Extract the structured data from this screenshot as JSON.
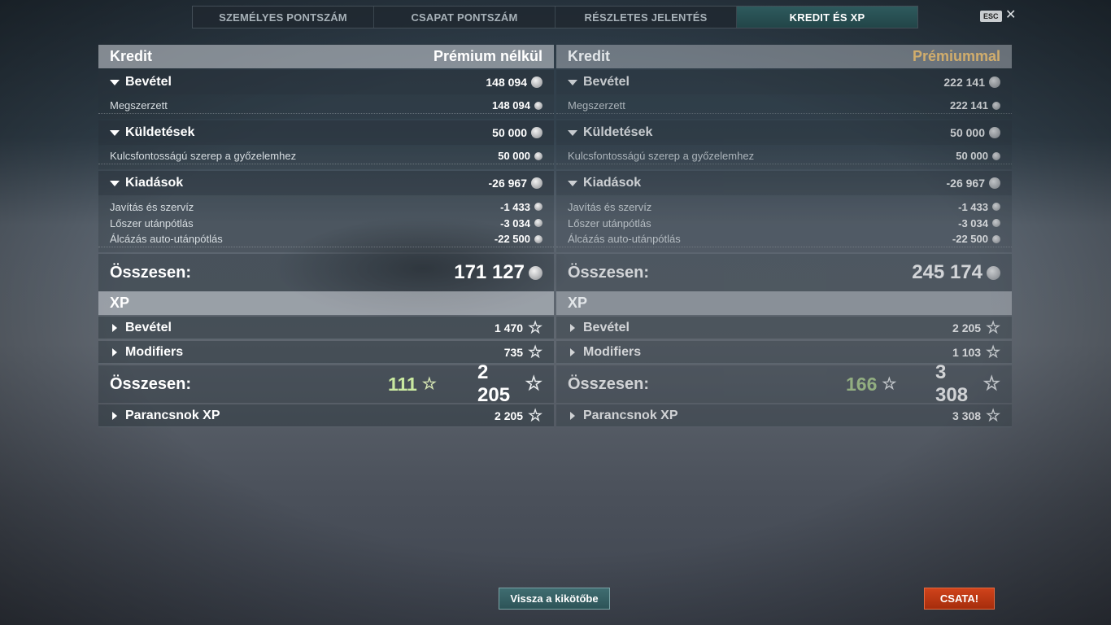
{
  "tabs": [
    {
      "label": "SZEMÉLYES PONTSZÁM"
    },
    {
      "label": "CSAPAT PONTSZÁM"
    },
    {
      "label": "RÉSZLETES JELENTÉS"
    },
    {
      "label": "KREDIT ÉS XP"
    }
  ],
  "esc_label": "ESC",
  "close_glyph": "✕",
  "left": {
    "header": {
      "title": "Kredit",
      "mode": "Prémium nélkül"
    },
    "bevetel": {
      "label": "Bevétel",
      "value": "148 094"
    },
    "megszerzett": {
      "label": "Megszerzett",
      "value": "148 094"
    },
    "kuldetesek": {
      "label": "Küldetések",
      "value": "50 000"
    },
    "kulcs": {
      "label": "Kulcsfontosságú szerep a győzelemhez",
      "value": "50 000"
    },
    "kiadasok": {
      "label": "Kiadások",
      "value": "-26 967"
    },
    "javitas": {
      "label": "Javítás és szervíz",
      "value": "-1 433"
    },
    "loszer": {
      "label": "Lőszer utánpótlás",
      "value": "-3 034"
    },
    "alcazas": {
      "label": "Álcázás auto-utánpótlás",
      "value": "-22 500"
    },
    "total": {
      "label": "Összesen:",
      "value": "171 127"
    },
    "xp_header": "XP",
    "xp_bevetel": {
      "label": "Bevétel",
      "value": "1 470"
    },
    "xp_mod": {
      "label": "Modifiers",
      "value": "735"
    },
    "xp_total": {
      "label": "Összesen:",
      "free": "111",
      "value": "2 205"
    },
    "parancsnok": {
      "label": "Parancsnok XP",
      "value": "2 205"
    }
  },
  "right": {
    "header": {
      "title": "Kredit",
      "mode": "Prémiummal"
    },
    "bevetel": {
      "label": "Bevétel",
      "value": "222 141"
    },
    "megszerzett": {
      "label": "Megszerzett",
      "value": "222 141"
    },
    "kuldetesek": {
      "label": "Küldetések",
      "value": "50 000"
    },
    "kulcs": {
      "label": "Kulcsfontosságú szerep a győzelemhez",
      "value": "50 000"
    },
    "kiadasok": {
      "label": "Kiadások",
      "value": "-26 967"
    },
    "javitas": {
      "label": "Javítás és szervíz",
      "value": "-1 433"
    },
    "loszer": {
      "label": "Lőszer utánpótlás",
      "value": "-3 034"
    },
    "alcazas": {
      "label": "Álcázás auto-utánpótlás",
      "value": "-22 500"
    },
    "total": {
      "label": "Összesen:",
      "value": "245 174"
    },
    "xp_header": "XP",
    "xp_bevetel": {
      "label": "Bevétel",
      "value": "2 205"
    },
    "xp_mod": {
      "label": "Modifiers",
      "value": "1 103"
    },
    "xp_total": {
      "label": "Összesen:",
      "free": "166",
      "value": "3 308"
    },
    "parancsnok": {
      "label": "Parancsnok XP",
      "value": "3 308"
    }
  },
  "buttons": {
    "back": "Vissza a kikötőbe",
    "battle": "CSATA!"
  },
  "colors": {
    "premium": "#d1ad6c",
    "free_xp": "#c9e9a0",
    "battle": "#c23a14",
    "tab_active": "#2e5a5d"
  },
  "icons": {
    "credit": "credit-coin-icon",
    "xp": "xp-star-icon"
  }
}
